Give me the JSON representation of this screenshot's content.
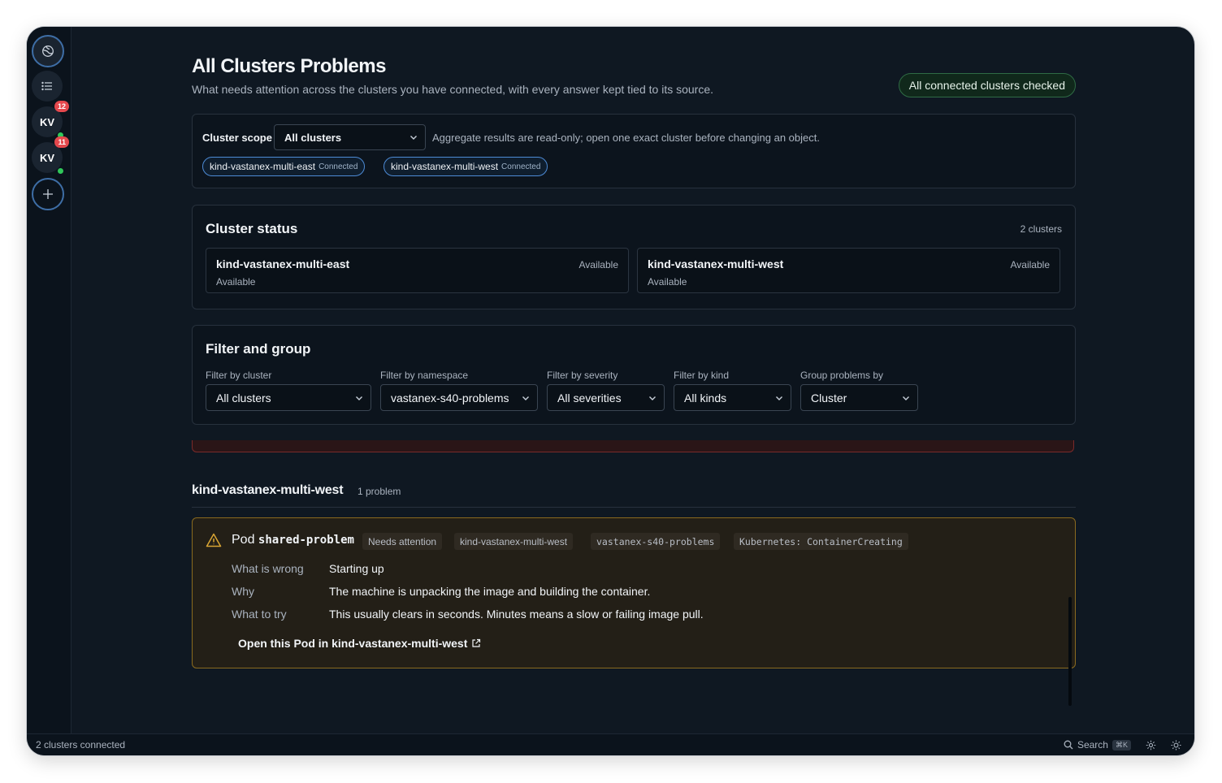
{
  "rail": {
    "items": [
      {
        "name": "home",
        "kind": "icon"
      },
      {
        "name": "list",
        "kind": "icon"
      },
      {
        "name": "cluster-1",
        "label": "KV",
        "badge": "12"
      },
      {
        "name": "cluster-2",
        "label": "KV",
        "badge": "11"
      },
      {
        "name": "add",
        "kind": "icon"
      }
    ]
  },
  "page": {
    "title": "All Clusters Problems",
    "subtitle": "What needs attention across the clusters you have connected, with every answer kept tied to its source.",
    "checked_pill": "All connected clusters checked"
  },
  "scope": {
    "label": "Cluster scope",
    "selected": "All clusters",
    "note": "Aggregate results are read-only; open one exact cluster before changing an object.",
    "chips": [
      {
        "name": "kind-vastanex-multi-east",
        "status": "Connected"
      },
      {
        "name": "kind-vastanex-multi-west",
        "status": "Connected"
      }
    ]
  },
  "cluster_status": {
    "title": "Cluster status",
    "count": "2 clusters",
    "clusters": [
      {
        "name": "kind-vastanex-multi-east",
        "status": "Available",
        "detail": "Available"
      },
      {
        "name": "kind-vastanex-multi-west",
        "status": "Available",
        "detail": "Available"
      }
    ]
  },
  "filters": {
    "title": "Filter and group",
    "cluster": {
      "label": "Filter by cluster",
      "value": "All clusters"
    },
    "namespace": {
      "label": "Filter by namespace",
      "value": "vastanex-s40-problems"
    },
    "severity": {
      "label": "Filter by severity",
      "value": "All severities"
    },
    "kind": {
      "label": "Filter by kind",
      "value": "All kinds"
    },
    "group": {
      "label": "Group problems by",
      "value": "Cluster"
    }
  },
  "group": {
    "title": "kind-vastanex-multi-west",
    "count": "1 problem"
  },
  "problem": {
    "kind": "Pod",
    "name": "shared-problem",
    "tags": [
      "Needs attention",
      "kind-vastanex-multi-west",
      "vastanex-s40-problems",
      "Kubernetes: ContainerCreating"
    ],
    "rows": [
      {
        "k": "What is wrong",
        "v": "Starting up"
      },
      {
        "k": "Why",
        "v": "The machine is unpacking the image and building the container."
      },
      {
        "k": "What to try",
        "v": "This usually clears in seconds. Minutes means a slow or failing image pull."
      }
    ],
    "link": "Open this Pod in kind-vastanex-multi-west"
  },
  "statusbar": {
    "left": "2 clusters connected",
    "search": "Search",
    "shortcut": "⌘K"
  },
  "colors": {
    "accent": "#4d8bd6",
    "success": "#30c75a",
    "danger": "#e5484d",
    "warning": "#d9a534"
  }
}
